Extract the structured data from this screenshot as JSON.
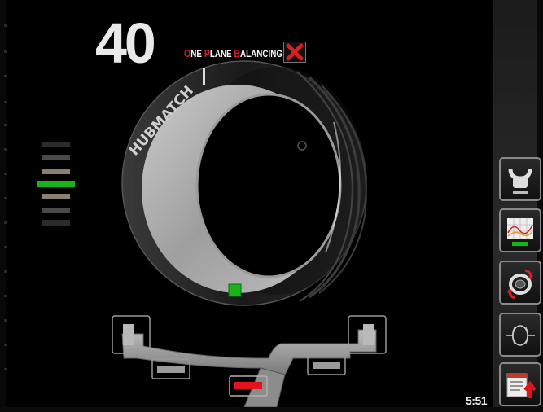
{
  "weight_display": {
    "value": "40"
  },
  "mode_title": {
    "words": [
      {
        "cap": "O",
        "rest": "NE"
      },
      {
        "cap": "P",
        "rest": "LANE"
      },
      {
        "cap": "B",
        "rest": "ALANCING"
      }
    ]
  },
  "wheel": {
    "brand_text": "HUBMATCH"
  },
  "clock": {
    "time": "5:51"
  },
  "position_indicator": {
    "active_index": 3,
    "bar_colors": [
      "#2b2b2b",
      "#4a4a4a",
      "#8b7f6e",
      "#16b51c",
      "#8b7f6e",
      "#4a4a4a",
      "#2b2b2b"
    ]
  },
  "side_menu": [
    {
      "name": "balancing-weights-button",
      "icon": "clip-weight-icon"
    },
    {
      "name": "optimization-graph-button",
      "icon": "graph-icon"
    },
    {
      "name": "rotate-wheel-button",
      "icon": "rotate-wheel-icon"
    },
    {
      "name": "wheel-centering-button",
      "icon": "centering-icon"
    },
    {
      "name": "report-export-button",
      "icon": "report-export-icon"
    }
  ],
  "colors": {
    "accent_red": "#d42020",
    "active_green": "#16b51c",
    "weight_red": "#e0141a"
  }
}
